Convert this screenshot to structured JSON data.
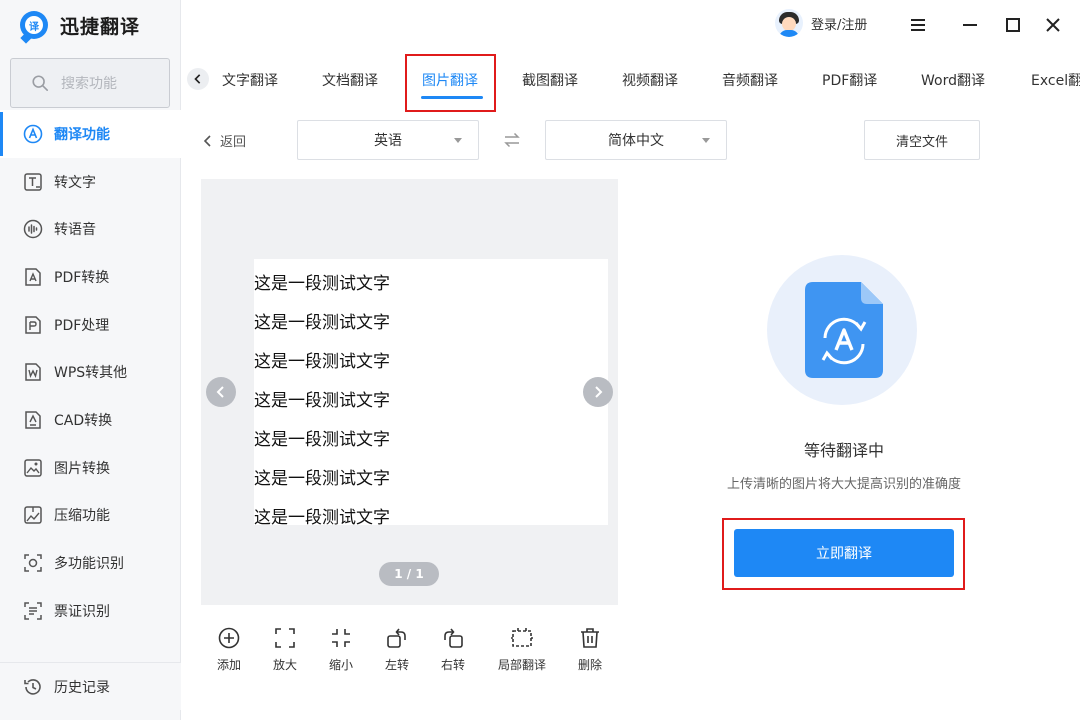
{
  "app": {
    "name": "迅捷翻译",
    "logo_glyph": "译"
  },
  "sidebar": {
    "search_placeholder": "搜索功能",
    "items": [
      {
        "label": "翻译功能",
        "icon": "translate-icon",
        "active": true
      },
      {
        "label": "转文字",
        "icon": "text-convert-icon"
      },
      {
        "label": "转语音",
        "icon": "voice-icon"
      },
      {
        "label": "PDF转换",
        "icon": "pdf-convert-icon"
      },
      {
        "label": "PDF处理",
        "icon": "pdf-process-icon"
      },
      {
        "label": "WPS转其他",
        "icon": "wps-icon"
      },
      {
        "label": "CAD转换",
        "icon": "cad-icon"
      },
      {
        "label": "图片转换",
        "icon": "image-convert-icon"
      },
      {
        "label": "压缩功能",
        "icon": "compress-icon"
      },
      {
        "label": "多功能识别",
        "icon": "multi-recognize-icon"
      },
      {
        "label": "票证识别",
        "icon": "ticket-recognize-icon"
      }
    ],
    "history_label": "历史记录"
  },
  "header": {
    "login_label": "登录/注册"
  },
  "tabs": [
    {
      "label": "文字翻译"
    },
    {
      "label": "文档翻译"
    },
    {
      "label": "图片翻译",
      "active": true
    },
    {
      "label": "截图翻译"
    },
    {
      "label": "视频翻译"
    },
    {
      "label": "音频翻译"
    },
    {
      "label": "PDF翻译"
    },
    {
      "label": "Word翻译"
    },
    {
      "label": "Excel翻"
    }
  ],
  "toolbar": {
    "back_label": "返回",
    "source_lang": "英语",
    "target_lang": "简体中文",
    "clear_label": "清空文件"
  },
  "preview": {
    "lines": [
      "这是一段测试文字",
      "这是一段测试文字",
      "这是一段测试文字",
      "这是一段测试文字",
      "这是一段测试文字",
      "这是一段测试文字",
      "这是一段测试文字"
    ],
    "page_indicator": "1 / 1"
  },
  "tools": [
    {
      "label": "添加",
      "icon": "add-icon"
    },
    {
      "label": "放大",
      "icon": "zoom-in-icon"
    },
    {
      "label": "缩小",
      "icon": "zoom-out-icon"
    },
    {
      "label": "左转",
      "icon": "rotate-left-icon"
    },
    {
      "label": "右转",
      "icon": "rotate-right-icon"
    },
    {
      "label": "局部翻译",
      "icon": "partial-translate-icon"
    },
    {
      "label": "删除",
      "icon": "delete-icon"
    }
  ],
  "status": {
    "title": "等待翻译中",
    "hint": "上传清晰的图片将大大提高识别的准确度",
    "action_label": "立即翻译"
  },
  "colors": {
    "accent": "#1e88f5",
    "highlight": "#e01b1b"
  }
}
